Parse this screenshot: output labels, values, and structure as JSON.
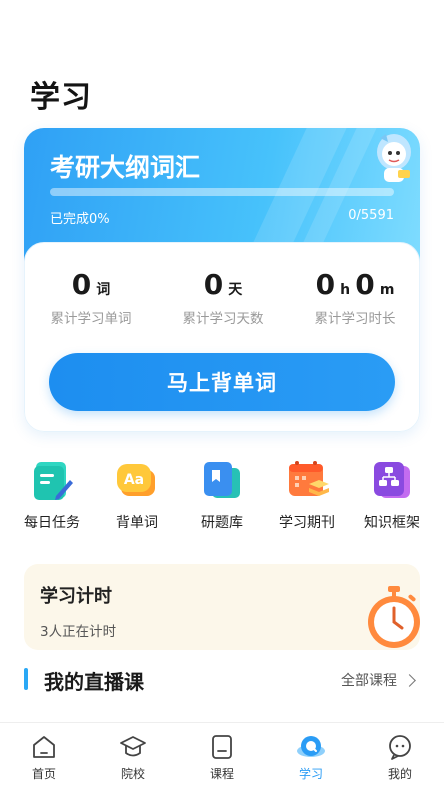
{
  "page": {
    "title": "学习"
  },
  "vocab_card": {
    "book_title": "考研大纲词汇",
    "progress_percent": 0,
    "progress_label": "已完成0%",
    "progress_count": "0/5591",
    "stats": [
      {
        "value": "0",
        "unit": "词",
        "label": "累计学习单词"
      },
      {
        "value": "0",
        "unit": "天",
        "label": "累计学习天数"
      },
      {
        "value_h": "0",
        "unit_h": "h",
        "value_m": "0",
        "unit_m": "m",
        "label": "累计学习时长"
      }
    ],
    "start_button": "马上背单词"
  },
  "shortcuts": [
    {
      "label": "每日任务",
      "icon": "daily-task-icon"
    },
    {
      "label": "背单词",
      "icon": "vocabulary-icon"
    },
    {
      "label": "研题库",
      "icon": "question-bank-icon"
    },
    {
      "label": "学习期刊",
      "icon": "journal-icon"
    },
    {
      "label": "知识框架",
      "icon": "knowledge-framework-icon"
    }
  ],
  "timer": {
    "title": "学习计时",
    "subtitle": "3人正在计时"
  },
  "live": {
    "title": "我的直播课",
    "all_link": "全部课程"
  },
  "tabs": [
    {
      "label": "首页",
      "icon": "home-icon"
    },
    {
      "label": "院校",
      "icon": "school-icon"
    },
    {
      "label": "课程",
      "icon": "course-icon"
    },
    {
      "label": "学习",
      "icon": "study-icon",
      "active": true
    },
    {
      "label": "我的",
      "icon": "profile-icon"
    }
  ],
  "colors": {
    "accent": "#2a9cf5",
    "card_gradient_start": "#2fa0f5",
    "timer_bg": "#fcf7ea"
  }
}
